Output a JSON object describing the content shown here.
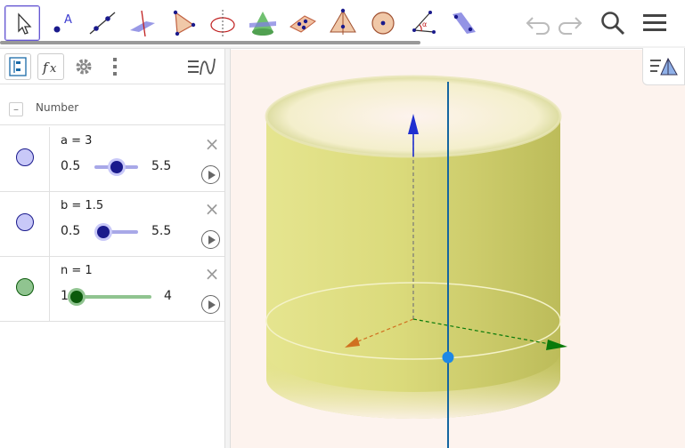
{
  "toolbar": {
    "tools": [
      {
        "name": "move"
      },
      {
        "name": "point"
      },
      {
        "name": "line"
      },
      {
        "name": "perpendicular-line"
      },
      {
        "name": "polygon"
      },
      {
        "name": "circle-around-axis"
      },
      {
        "name": "intersect"
      },
      {
        "name": "plane-through-points"
      },
      {
        "name": "pyramid"
      },
      {
        "name": "sphere"
      },
      {
        "name": "angle"
      },
      {
        "name": "reflect-about-plane"
      }
    ],
    "undo_icon": "undo-icon",
    "redo_icon": "redo-icon",
    "search_icon": "search-icon",
    "menu_icon": "menu-icon"
  },
  "algebra": {
    "group_label": "Number",
    "group_toggle": "–",
    "items": [
      {
        "definition": "a = 3",
        "min": "0.5",
        "max": "5.5",
        "value": 3,
        "range": [
          0.5,
          5.5
        ],
        "color": "#1a1a8c",
        "marble_color": "#c8c8f8"
      },
      {
        "definition": "b = 1.5",
        "min": "0.5",
        "max": "5.5",
        "value": 1.5,
        "range": [
          0.5,
          5.5
        ],
        "color": "#1a1a8c",
        "marble_color": "#c8c8f8"
      },
      {
        "definition": "n = 1",
        "min": "1",
        "max": "4",
        "value": 1,
        "range": [
          1,
          4
        ],
        "color": "#0b5a0b",
        "marble_color": "#90c490"
      }
    ],
    "delete_glyph": "×"
  },
  "colors": {
    "accent": "#6557d2",
    "cylinder": "#d8d86a",
    "z_axis": "#1f2fd0",
    "x_axis": "#d07020",
    "y_axis": "#0a7a0a",
    "line": "#1565a0",
    "point": "#1e88e5"
  }
}
